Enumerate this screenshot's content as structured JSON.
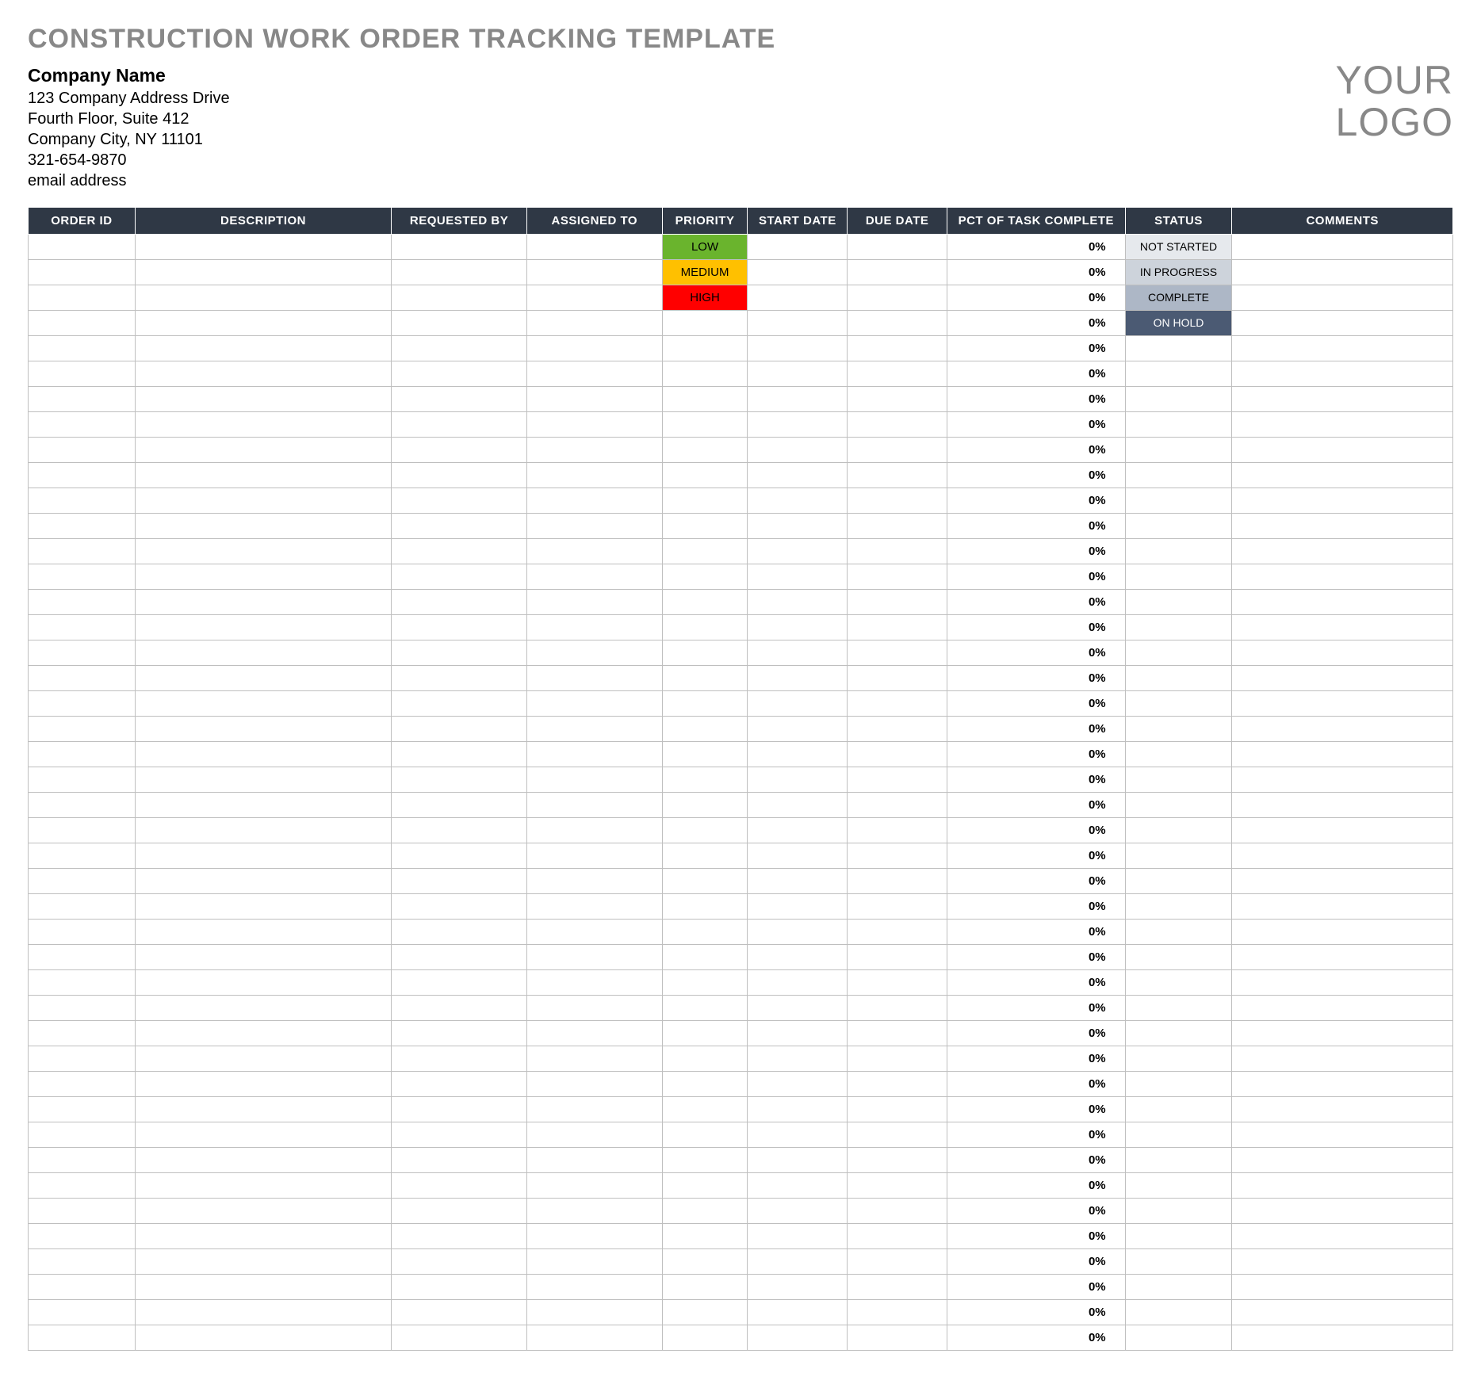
{
  "title": "CONSTRUCTION WORK ORDER TRACKING TEMPLATE",
  "company": {
    "name": "Company Name",
    "line1": "123 Company Address Drive",
    "line2": "Fourth Floor, Suite 412",
    "line3": "Company City, NY  11101",
    "phone": "321-654-9870",
    "email": "email address"
  },
  "logo": {
    "line1": "YOUR",
    "line2": "LOGO"
  },
  "columns": {
    "order_id": "ORDER ID",
    "description": "DESCRIPTION",
    "requested_by": "REQUESTED BY",
    "assigned_to": "ASSIGNED TO",
    "priority": "PRIORITY",
    "start_date": "START DATE",
    "due_date": "DUE DATE",
    "pct_complete": "PCT OF TASK COMPLETE",
    "status": "STATUS",
    "comments": "COMMENTS"
  },
  "priority_labels": {
    "low": "LOW",
    "medium": "MEDIUM",
    "high": "HIGH"
  },
  "status_labels": {
    "not_started": "NOT STARTED",
    "in_progress": "IN PROGRESS",
    "complete": "COMPLETE",
    "on_hold": "ON HOLD"
  },
  "rows": [
    {
      "priority": "low",
      "status": "not_started",
      "pct": "0%"
    },
    {
      "priority": "medium",
      "status": "in_progress",
      "pct": "0%"
    },
    {
      "priority": "high",
      "status": "complete",
      "pct": "0%"
    },
    {
      "priority": "",
      "status": "on_hold",
      "pct": "0%"
    },
    {
      "pct": "0%"
    },
    {
      "pct": "0%"
    },
    {
      "pct": "0%"
    },
    {
      "pct": "0%"
    },
    {
      "pct": "0%"
    },
    {
      "pct": "0%"
    },
    {
      "pct": "0%"
    },
    {
      "pct": "0%"
    },
    {
      "pct": "0%"
    },
    {
      "pct": "0%"
    },
    {
      "pct": "0%"
    },
    {
      "pct": "0%"
    },
    {
      "pct": "0%"
    },
    {
      "pct": "0%"
    },
    {
      "pct": "0%"
    },
    {
      "pct": "0%"
    },
    {
      "pct": "0%"
    },
    {
      "pct": "0%"
    },
    {
      "pct": "0%"
    },
    {
      "pct": "0%"
    },
    {
      "pct": "0%"
    },
    {
      "pct": "0%"
    },
    {
      "pct": "0%"
    },
    {
      "pct": "0%"
    },
    {
      "pct": "0%"
    },
    {
      "pct": "0%"
    },
    {
      "pct": "0%"
    },
    {
      "pct": "0%"
    },
    {
      "pct": "0%"
    },
    {
      "pct": "0%"
    },
    {
      "pct": "0%"
    },
    {
      "pct": "0%"
    },
    {
      "pct": "0%"
    },
    {
      "pct": "0%"
    },
    {
      "pct": "0%"
    },
    {
      "pct": "0%"
    },
    {
      "pct": "0%"
    },
    {
      "pct": "0%"
    },
    {
      "pct": "0%"
    },
    {
      "pct": "0%"
    }
  ]
}
